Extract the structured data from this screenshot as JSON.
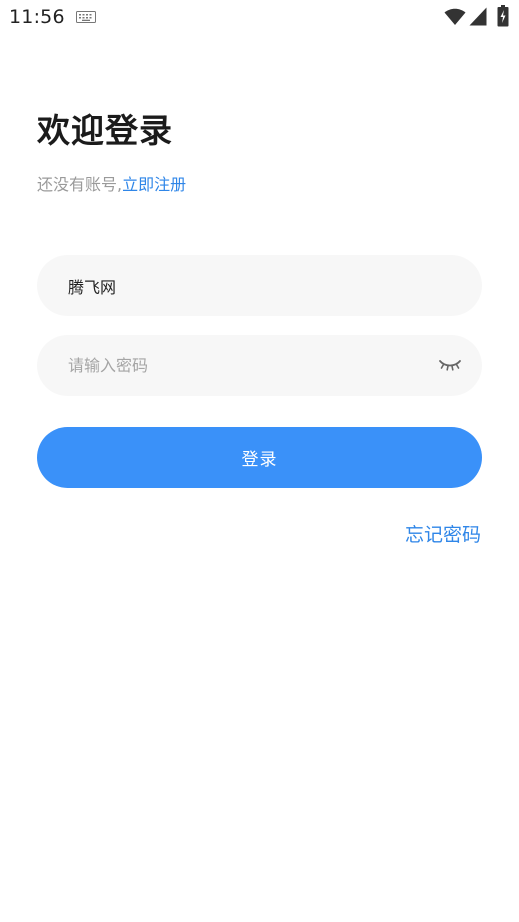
{
  "status_bar": {
    "time": "11:56",
    "icons": [
      "keyboard-icon",
      "wifi-icon",
      "signal-icon",
      "battery-icon"
    ]
  },
  "header": {
    "title": "欢迎登录",
    "register_prompt": "还没有账号,",
    "register_link": "立即注册"
  },
  "form": {
    "username_value": "腾飞网",
    "password_placeholder": "请输入密码",
    "password_toggle_icon": "eye-closed-icon",
    "login_label": "登录",
    "forgot_label": "忘记密码"
  },
  "colors": {
    "accent": "#3a91f9",
    "link": "#2f86e8",
    "field_bg": "#f7f7f7",
    "muted_text": "#9a9a9a"
  }
}
